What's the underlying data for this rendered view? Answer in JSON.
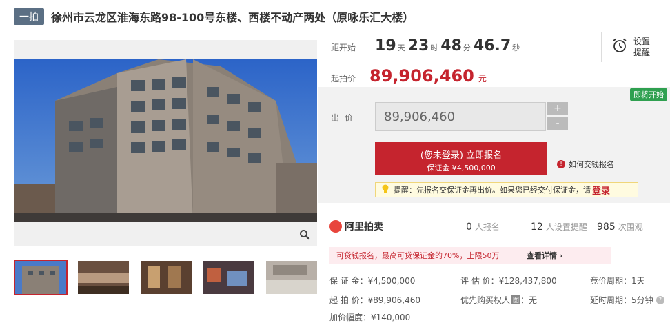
{
  "header": {
    "badge": "一拍",
    "title": "徐州市云龙区淮海东路98-100号东楼、西楼不动产两处（原咏乐汇大楼）"
  },
  "countdown": {
    "label": "距开始",
    "days": "19",
    "days_unit": "天",
    "hours": "23",
    "hours_unit": "时",
    "minutes": "48",
    "minutes_unit": "分",
    "seconds": "46.7",
    "seconds_unit": "秒"
  },
  "remind": {
    "line1": "设置",
    "line2": "提醒",
    "icon": "alarm-clock-icon"
  },
  "start_price": {
    "label": "起拍价",
    "value": "89,906,460",
    "unit": "元"
  },
  "bid": {
    "status_badge": "即将开始",
    "label": "出价",
    "input_value": "89,906,460",
    "plus": "+",
    "minus": "-",
    "signup_line1": "(您未登录) 立即报名",
    "signup_line2": "保证金 ¥4,500,000",
    "how_label": "如何交钱报名",
    "tip_text": "提醒：先报名交保证金再出价。如果您已经交付保证金，请",
    "tip_login": "登录"
  },
  "platform": {
    "name": "阿里拍卖"
  },
  "stats": {
    "signup_count": "0",
    "signup_label": "人报名",
    "remind_count": "12",
    "remind_label": "人设置提醒",
    "view_count": "985",
    "view_label": "次围观"
  },
  "loan": {
    "text": "可贷钱报名，最高可贷保证金的70%，上限50万",
    "more": "查看详情 ›"
  },
  "details": {
    "deposit": "保 证 金：¥4,500,000",
    "appraisal": "评 估 价：¥128,437,800",
    "cycle": "竞价周期：1天",
    "start": "起 拍 价：¥89,906,460",
    "priority": "优先购买权人",
    "priority_tag": "图",
    "priority_value": "：无",
    "delay": "延时周期：5分钟",
    "increment": "加价幅度：¥140,000"
  },
  "colors": {
    "accent": "#c5242e",
    "badge": "#5b6f84",
    "green": "#2fa050"
  }
}
